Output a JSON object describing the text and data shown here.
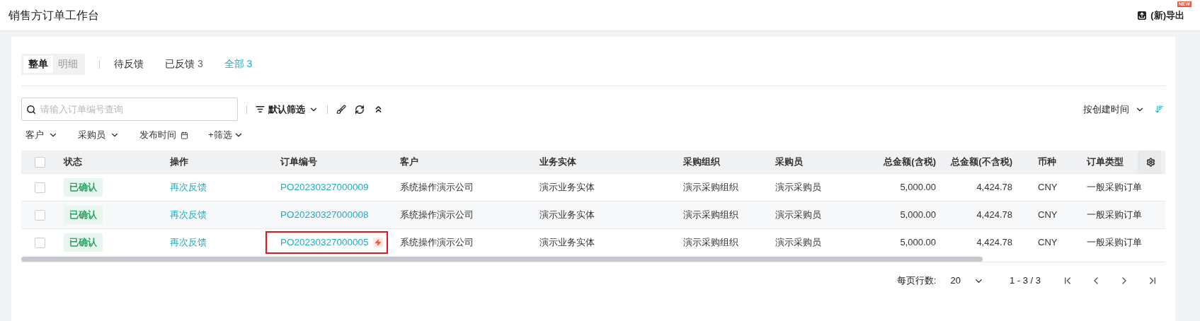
{
  "header": {
    "title": "销售方订单工作台",
    "export_button": "(新)导出",
    "export_badge": "NEW"
  },
  "view_toggle": [
    {
      "label": "整单",
      "selected": true
    },
    {
      "label": "明细",
      "selected": false
    }
  ],
  "status_tabs": [
    {
      "label": "待反馈",
      "selected": false
    },
    {
      "label": "已反馈",
      "count": "3",
      "selected": false
    },
    {
      "label": "全部",
      "count": "3",
      "selected": true
    }
  ],
  "search": {
    "placeholder": "请输入订单编号查询"
  },
  "default_filter": "默认筛选",
  "sort": {
    "label": "按创建时间"
  },
  "filters": [
    {
      "label": "客户",
      "kind": "dropdown"
    },
    {
      "label": "采购员",
      "kind": "dropdown"
    },
    {
      "label": "发布时间",
      "kind": "date"
    },
    {
      "label": "+筛选",
      "kind": "add"
    }
  ],
  "table": {
    "select_all": {
      "checked": false
    },
    "columns": [
      "状态",
      "操作",
      "订单编号",
      "客户",
      "业务实体",
      "采购组织",
      "采购员",
      "总金额(含税)",
      "总金额(不含税)",
      "币种",
      "订单类型"
    ],
    "rows": [
      {
        "checked": false,
        "status": "已确认",
        "action": "再次反馈",
        "order_no": "PO20230327000009",
        "flagged": false,
        "outlined": false,
        "customer": "系统操作演示公司",
        "entity": "演示业务实体",
        "org": "演示采购组织",
        "buyer": "演示采购员",
        "total_tax": "5,000.00",
        "total_net": "4,424.78",
        "currency": "CNY",
        "type": "一般采购订单"
      },
      {
        "checked": false,
        "status": "已确认",
        "action": "再次反馈",
        "order_no": "PO20230327000008",
        "flagged": false,
        "outlined": false,
        "customer": "系统操作演示公司",
        "entity": "演示业务实体",
        "org": "演示采购组织",
        "buyer": "演示采购员",
        "total_tax": "5,000.00",
        "total_net": "4,424.78",
        "currency": "CNY",
        "type": "一般采购订单"
      },
      {
        "checked": false,
        "status": "已确认",
        "action": "再次反馈",
        "order_no": "PO20230327000005",
        "flagged": true,
        "outlined": true,
        "customer": "系统操作演示公司",
        "entity": "演示业务实体",
        "org": "演示采购组织",
        "buyer": "演示采购员",
        "total_tax": "5,000.00",
        "total_net": "4,424.78",
        "currency": "CNY",
        "type": "一般采购订单"
      }
    ]
  },
  "pagination": {
    "rows_label": "每页行数:",
    "page_size": "20",
    "range": "1 - 3 / 3"
  }
}
